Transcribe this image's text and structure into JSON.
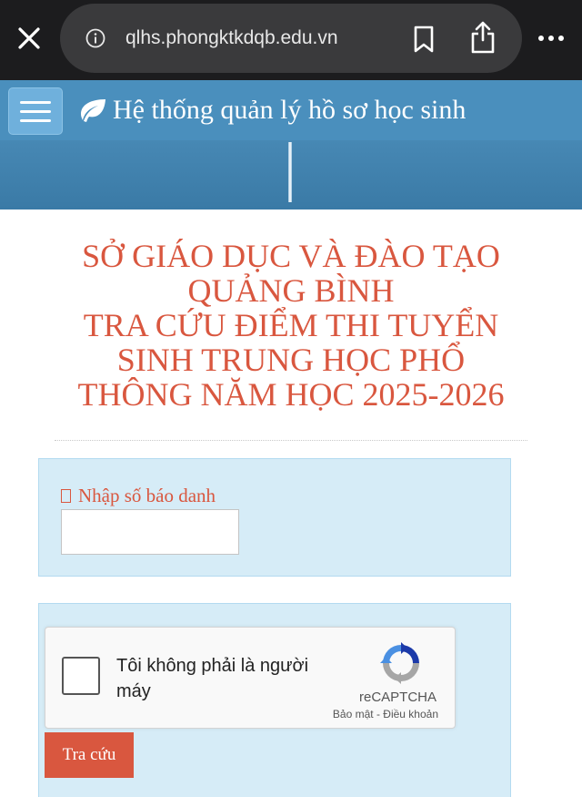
{
  "browser": {
    "url": "qlhs.phongktkdqb.edu.vn",
    "close_icon": "close-icon",
    "info_icon": "info-icon",
    "bookmark_icon": "bookmark-icon",
    "share_icon": "share-icon",
    "more_icon": "more-icon"
  },
  "header": {
    "menu_icon": "hamburger-icon",
    "logo_icon": "leaf-icon",
    "title": "Hệ thống quản lý hồ sơ học sinh"
  },
  "page": {
    "title_lines": [
      "SỞ GIÁO DỤC VÀ ĐÀO TẠO",
      "QUẢNG BÌNH",
      "TRA CỨU ĐIỂM THI TUYỂN",
      "SINH TRUNG HỌC PHỔ",
      "THÔNG NĂM HỌC 2025-2026"
    ]
  },
  "form": {
    "sbd_label": "Nhập số báo danh",
    "sbd_value": "",
    "submit_label": "Tra cứu"
  },
  "recaptcha": {
    "checkbox_label": "Tôi không phải là người máy",
    "brand": "reCAPTCHA",
    "privacy": "Bảo mật",
    "separator": " - ",
    "terms": "Điều khoản"
  },
  "colors": {
    "browser_bar": "#1c1c1e",
    "header_blue": "#4a8fbd",
    "title_red": "#d9573f",
    "panel_bg": "#d6ecf7",
    "button_red": "#d9573f"
  }
}
